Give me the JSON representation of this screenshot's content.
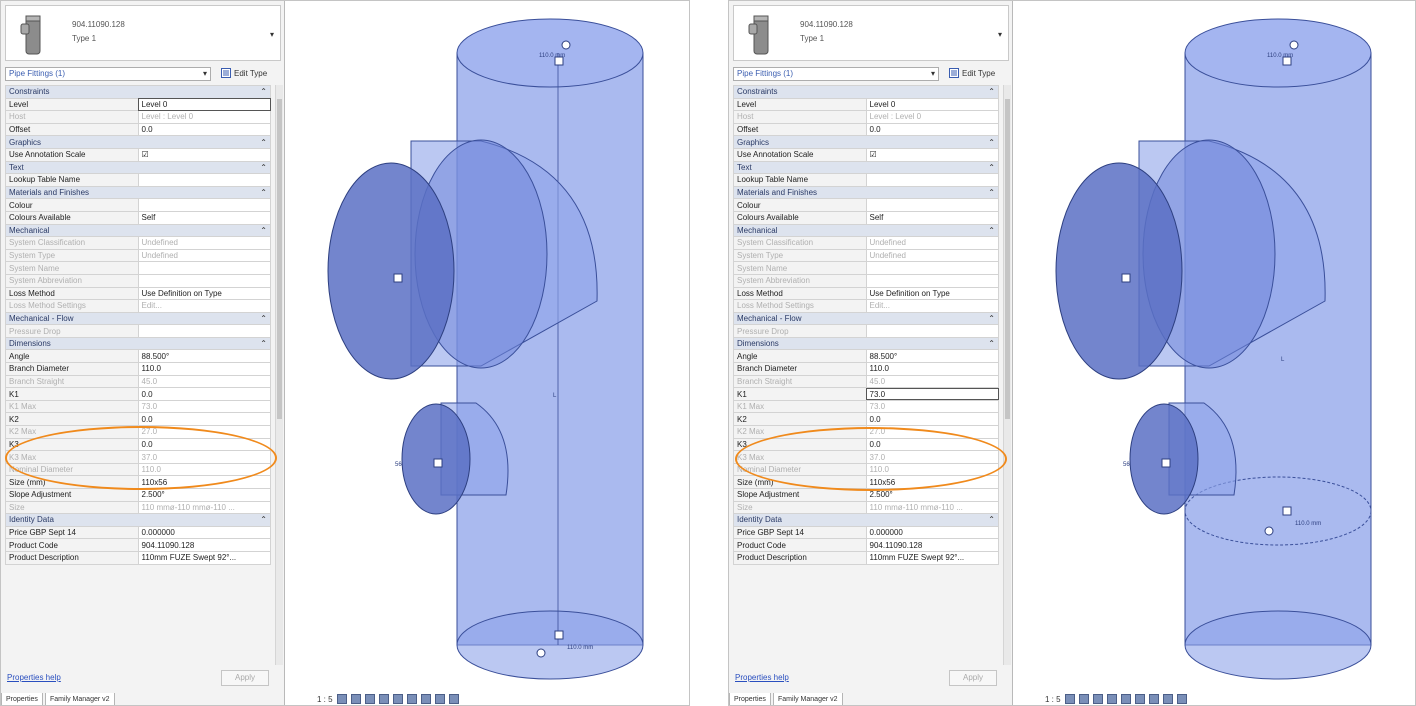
{
  "left": {
    "type_selector": {
      "code": "904.11090.128",
      "type": "Type 1"
    },
    "filter": "Pipe Fittings (1)",
    "edit_type": "Edit Type",
    "groups": [
      {
        "name": "Constraints",
        "rows": [
          {
            "n": "Level",
            "v": "Level 0",
            "dis": false,
            "active": true
          },
          {
            "n": "Host",
            "v": "Level : Level 0",
            "dis": true
          },
          {
            "n": "Offset",
            "v": "0.0",
            "dis": false
          }
        ]
      },
      {
        "name": "Graphics",
        "rows": [
          {
            "n": "Use Annotation Scale",
            "v": "☑",
            "dis": false
          }
        ]
      },
      {
        "name": "Text",
        "rows": [
          {
            "n": "Lookup Table Name",
            "v": "",
            "dis": false
          }
        ]
      },
      {
        "name": "Materials and Finishes",
        "rows": [
          {
            "n": "Colour",
            "v": "",
            "dis": false
          },
          {
            "n": "Colours Available",
            "v": "Self",
            "dis": false
          }
        ]
      },
      {
        "name": "Mechanical",
        "rows": [
          {
            "n": "System Classification",
            "v": "Undefined",
            "dis": true
          },
          {
            "n": "System Type",
            "v": "Undefined",
            "dis": true
          },
          {
            "n": "System Name",
            "v": "",
            "dis": true
          },
          {
            "n": "System Abbreviation",
            "v": "",
            "dis": true
          },
          {
            "n": "Loss Method",
            "v": "Use Definition on Type",
            "dis": false
          },
          {
            "n": "Loss Method Settings",
            "v": "Edit...",
            "dis": true
          }
        ]
      },
      {
        "name": "Mechanical - Flow",
        "rows": [
          {
            "n": "Pressure Drop",
            "v": "",
            "dis": true
          }
        ]
      },
      {
        "name": "Dimensions",
        "rows": [
          {
            "n": "Angle",
            "v": "88.500°",
            "dis": false
          },
          {
            "n": "Branch Diameter",
            "v": "110.0",
            "dis": false
          },
          {
            "n": "Branch Straight",
            "v": "45.0",
            "dis": true
          },
          {
            "n": "K1",
            "v": "0.0",
            "dis": false
          },
          {
            "n": "K1 Max",
            "v": "73.0",
            "dis": true
          },
          {
            "n": "K2",
            "v": "0.0",
            "dis": false
          },
          {
            "n": "K2 Max",
            "v": "27.0",
            "dis": true
          },
          {
            "n": "K3",
            "v": "0.0",
            "dis": false
          },
          {
            "n": "K3 Max",
            "v": "37.0",
            "dis": true
          },
          {
            "n": "Nominal Diameter",
            "v": "110.0",
            "dis": true
          },
          {
            "n": "Size (mm)",
            "v": "110x56",
            "dis": false
          },
          {
            "n": "Slope Adjustment",
            "v": "2.500°",
            "dis": false
          },
          {
            "n": "Size",
            "v": "110 mmø-110 mmø-110 ...",
            "dis": true
          }
        ]
      },
      {
        "name": "Identity Data",
        "rows": [
          {
            "n": "Price GBP Sept 14",
            "v": "0.000000",
            "dis": false
          },
          {
            "n": "Product Code",
            "v": "904.11090.128",
            "dis": false
          },
          {
            "n": "Product Description",
            "v": "110mm FUZE Swept 92°...",
            "dis": false
          }
        ]
      }
    ],
    "help": "Properties help",
    "apply": "Apply",
    "tabs": [
      "Properties",
      "Family Manager v2"
    ],
    "scale": "1 : 5",
    "labels": {
      "top": "110.0 mm",
      "mid": "L",
      "branch": "56",
      "bottom": "110.0 mm"
    }
  },
  "right": {
    "type_selector": {
      "code": "904.11090.128",
      "type": "Type 1"
    },
    "filter": "Pipe Fittings (1)",
    "edit_type": "Edit Type",
    "groups": [
      {
        "name": "Constraints",
        "rows": [
          {
            "n": "Level",
            "v": "Level 0",
            "dis": false
          },
          {
            "n": "Host",
            "v": "Level : Level 0",
            "dis": true
          },
          {
            "n": "Offset",
            "v": "0.0",
            "dis": false
          }
        ]
      },
      {
        "name": "Graphics",
        "rows": [
          {
            "n": "Use Annotation Scale",
            "v": "☑",
            "dis": false
          }
        ]
      },
      {
        "name": "Text",
        "rows": [
          {
            "n": "Lookup Table Name",
            "v": "",
            "dis": false
          }
        ]
      },
      {
        "name": "Materials and Finishes",
        "rows": [
          {
            "n": "Colour",
            "v": "",
            "dis": false
          },
          {
            "n": "Colours Available",
            "v": "Self",
            "dis": false
          }
        ]
      },
      {
        "name": "Mechanical",
        "rows": [
          {
            "n": "System Classification",
            "v": "Undefined",
            "dis": true
          },
          {
            "n": "System Type",
            "v": "Undefined",
            "dis": true
          },
          {
            "n": "System Name",
            "v": "",
            "dis": true
          },
          {
            "n": "System Abbreviation",
            "v": "",
            "dis": true
          },
          {
            "n": "Loss Method",
            "v": "Use Definition on Type",
            "dis": false
          },
          {
            "n": "Loss Method Settings",
            "v": "Edit...",
            "dis": true
          }
        ]
      },
      {
        "name": "Mechanical - Flow",
        "rows": [
          {
            "n": "Pressure Drop",
            "v": "",
            "dis": true
          }
        ]
      },
      {
        "name": "Dimensions",
        "rows": [
          {
            "n": "Angle",
            "v": "88.500°",
            "dis": false
          },
          {
            "n": "Branch Diameter",
            "v": "110.0",
            "dis": false
          },
          {
            "n": "Branch Straight",
            "v": "45.0",
            "dis": true
          },
          {
            "n": "K1",
            "v": "73.0",
            "dis": false,
            "active": true
          },
          {
            "n": "K1 Max",
            "v": "73.0",
            "dis": true
          },
          {
            "n": "K2",
            "v": "0.0",
            "dis": false
          },
          {
            "n": "K2 Max",
            "v": "27.0",
            "dis": true
          },
          {
            "n": "K3",
            "v": "0.0",
            "dis": false
          },
          {
            "n": "K3 Max",
            "v": "37.0",
            "dis": true
          },
          {
            "n": "Nominal Diameter",
            "v": "110.0",
            "dis": true
          },
          {
            "n": "Size (mm)",
            "v": "110x56",
            "dis": false
          },
          {
            "n": "Slope Adjustment",
            "v": "2.500°",
            "dis": false
          },
          {
            "n": "Size",
            "v": "110 mmø-110 mmø-110 ...",
            "dis": true
          }
        ]
      },
      {
        "name": "Identity Data",
        "rows": [
          {
            "n": "Price GBP Sept 14",
            "v": "0.000000",
            "dis": false
          },
          {
            "n": "Product Code",
            "v": "904.11090.128",
            "dis": false
          },
          {
            "n": "Product Description",
            "v": "110mm FUZE Swept 92°...",
            "dis": false
          }
        ]
      }
    ],
    "help": "Properties help",
    "apply": "Apply",
    "tabs": [
      "Properties",
      "Family Manager v2"
    ],
    "scale": "1 : 5",
    "labels": {
      "top": "110.0 mm",
      "mid": "L",
      "branch": "56",
      "bottom": "110.0 mm"
    }
  },
  "colors": {
    "highlight": "#f08a1c",
    "pipe_fill": "#7f97e6",
    "pipe_edge": "#3a4f9a",
    "group_bg": "#dde3ee"
  }
}
